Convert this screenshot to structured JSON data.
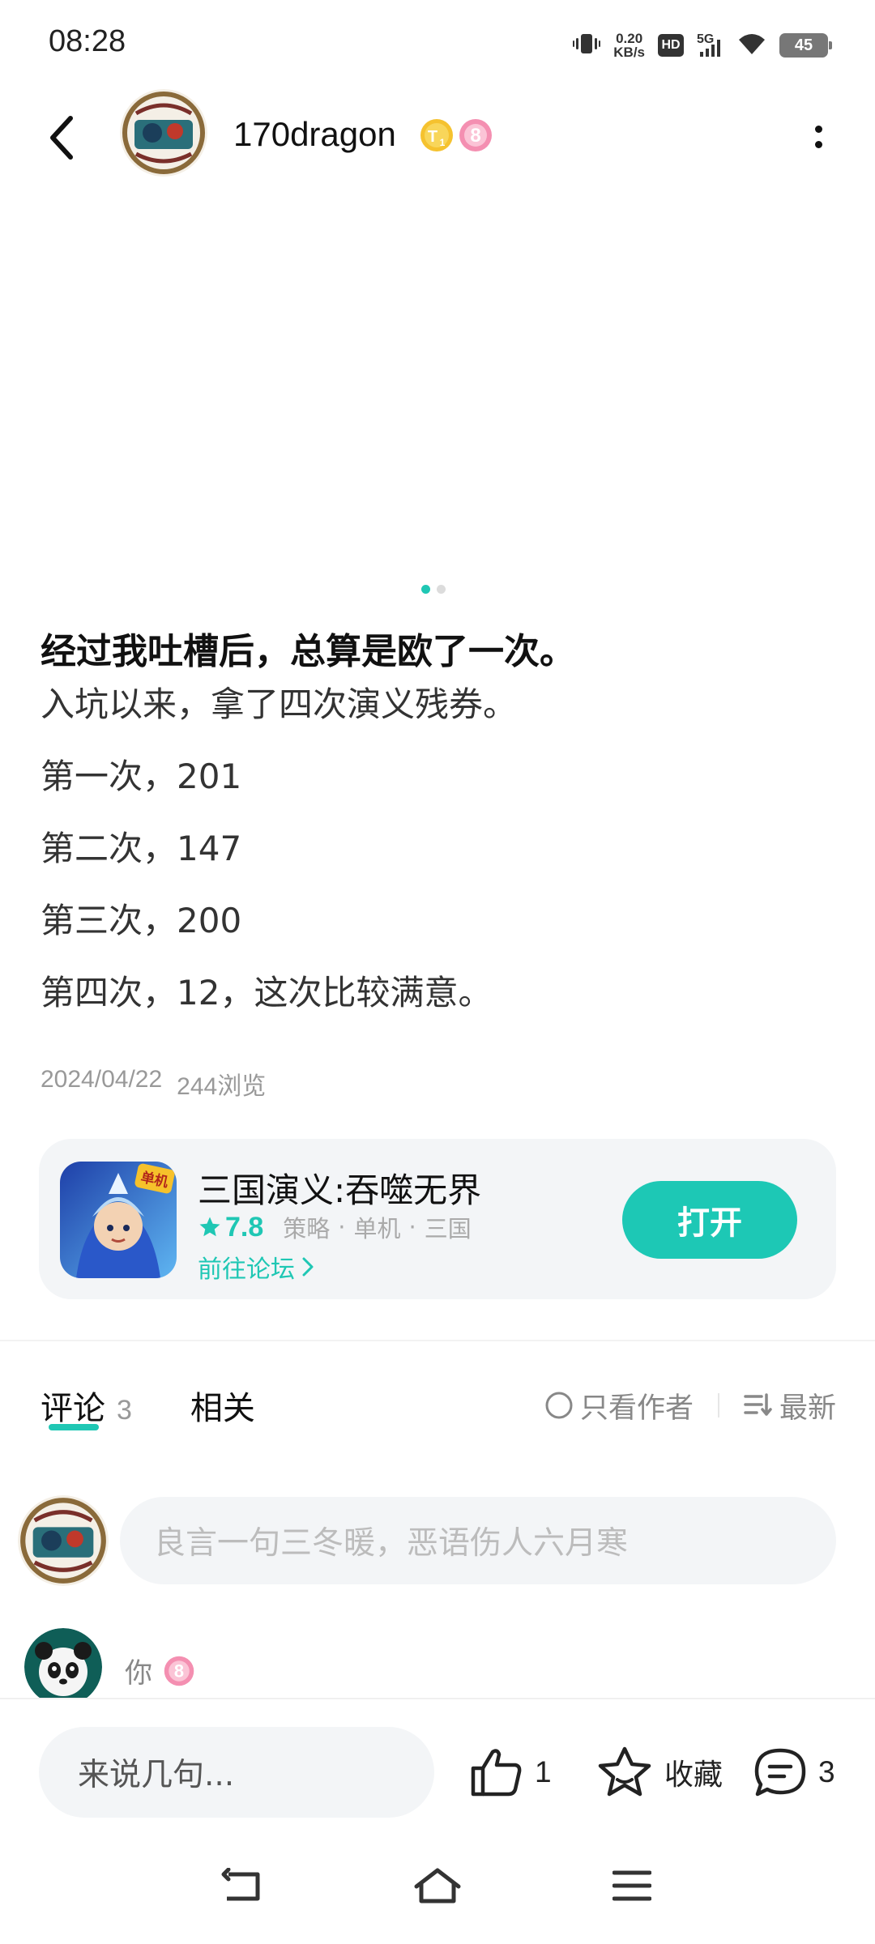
{
  "status_bar": {
    "time": "08:28",
    "speed_value": "0.20",
    "speed_unit": "KB/s",
    "hd": "HD",
    "network": "5G",
    "battery": "45"
  },
  "header": {
    "username": "170dragon",
    "badge_t": "T",
    "badge_t_sub": "1",
    "badge_level": "8"
  },
  "carousel": {
    "page_count": 2,
    "active_index": 0
  },
  "article": {
    "title": "经过我吐槽后，总算是欧了一次。",
    "paragraphs": [
      "入坑以来，拿了四次演义残券。",
      "第一次，201",
      "第二次，147",
      "第三次，200",
      "第四次，12，这次比较满意。"
    ],
    "date": "2024/04/22",
    "views": "244浏览"
  },
  "game_card": {
    "icon_badge": "单机",
    "name": "三国演义:吞噬无界",
    "rating": "7.8",
    "tags": [
      "策略",
      "单机",
      "三国"
    ],
    "tag_separator": "·",
    "forum_link": "前往论坛",
    "open_button": "打开"
  },
  "tabs": {
    "comments_label": "评论",
    "comments_count": "3",
    "related_label": "相关",
    "author_only": "只看作者",
    "sort_newest": "最新"
  },
  "comment_input": {
    "placeholder": "良言一句三冬暖，恶语伤人六月寒"
  },
  "comments": [
    {
      "user": "你",
      "level": "8"
    }
  ],
  "bottom_bar": {
    "input_placeholder": "来说几句...",
    "like_count": "1",
    "favorite_label": "收藏",
    "comment_count": "3"
  },
  "colors": {
    "accent": "#1fc7b4",
    "badge_gold": "#f5c22f",
    "badge_pink": "#f48fb1"
  }
}
